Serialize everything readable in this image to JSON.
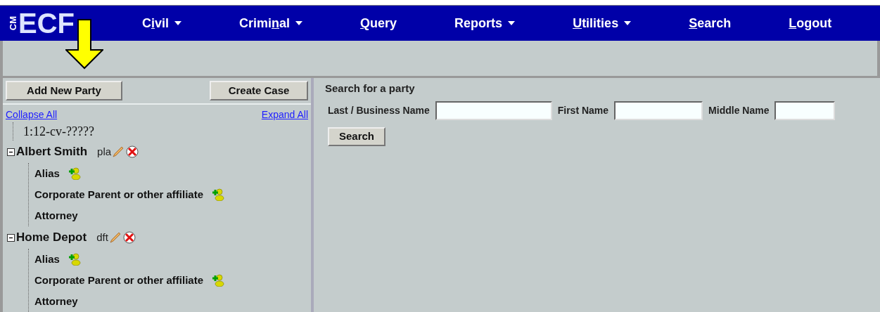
{
  "logo": {
    "small": "CM",
    "large": "ECF"
  },
  "menu": [
    {
      "before": "C",
      "key": "i",
      "after": "vil",
      "dropdown": true
    },
    {
      "before": "Crimi",
      "key": "n",
      "after": "al",
      "dropdown": true
    },
    {
      "key": "Q",
      "after": "uery",
      "dropdown": false
    },
    {
      "before": "Reports",
      "dropdown": true
    },
    {
      "key": "U",
      "after": "tilities",
      "dropdown": true
    },
    {
      "key": "S",
      "after": "earch",
      "dropdown": false
    },
    {
      "key": "L",
      "after": "ogout",
      "dropdown": false
    }
  ],
  "left": {
    "add_button": "Add New Party",
    "create_button": "Create Case",
    "collapse_link": "Collapse All",
    "expand_link": "Expand All",
    "case_number": "1:12-cv-?????",
    "parties": [
      {
        "name": "Albert Smith",
        "role": "pla",
        "expanded": true,
        "children": [
          {
            "label": "Alias",
            "kind": "add"
          },
          {
            "label": "Corporate Parent or other affiliate",
            "kind": "add"
          },
          {
            "label": "Attorney",
            "kind": "plain"
          }
        ]
      },
      {
        "name": "Home Depot",
        "role": "dft",
        "expanded": true,
        "children": [
          {
            "label": "Alias",
            "kind": "add"
          },
          {
            "label": "Corporate Parent or other affiliate",
            "kind": "add"
          },
          {
            "label": "Attorney",
            "kind": "plain"
          }
        ]
      }
    ]
  },
  "search": {
    "title": "Search for a party",
    "fields": [
      {
        "label": "Last / Business Name"
      },
      {
        "label": "First Name"
      },
      {
        "label": "Middle Name"
      }
    ],
    "button": "Search"
  }
}
